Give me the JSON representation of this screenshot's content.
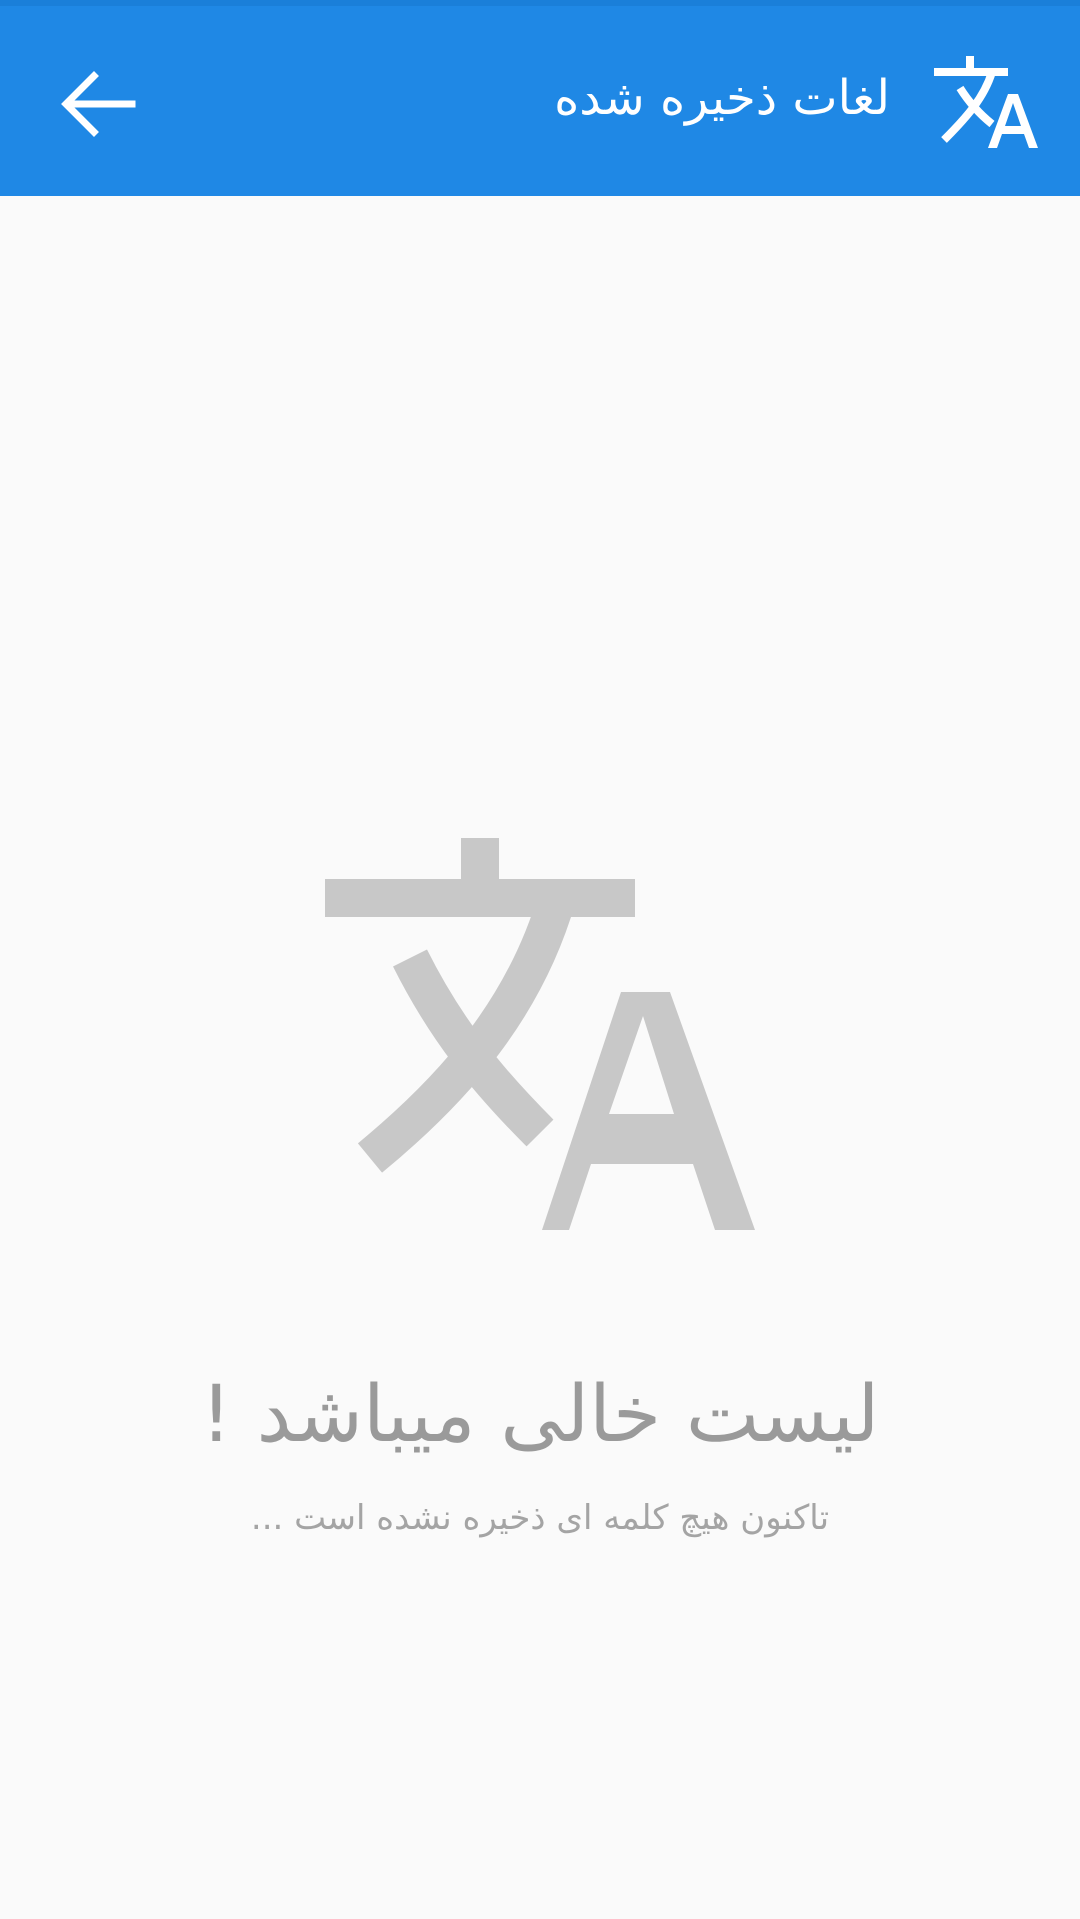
{
  "app_bar": {
    "title": "لغات ذخیره شده",
    "back_icon": "arrow-back-icon",
    "logo_icon": "translate-icon",
    "background_color": "#1f88e5",
    "text_color": "#ffffff"
  },
  "empty_state": {
    "icon": "translate-icon",
    "icon_color": "#c8c8c8",
    "title": "لیست خالی میباشد !",
    "subtitle": "تاکنون هیچ کلمه ای ذخیره نشده است ..."
  }
}
